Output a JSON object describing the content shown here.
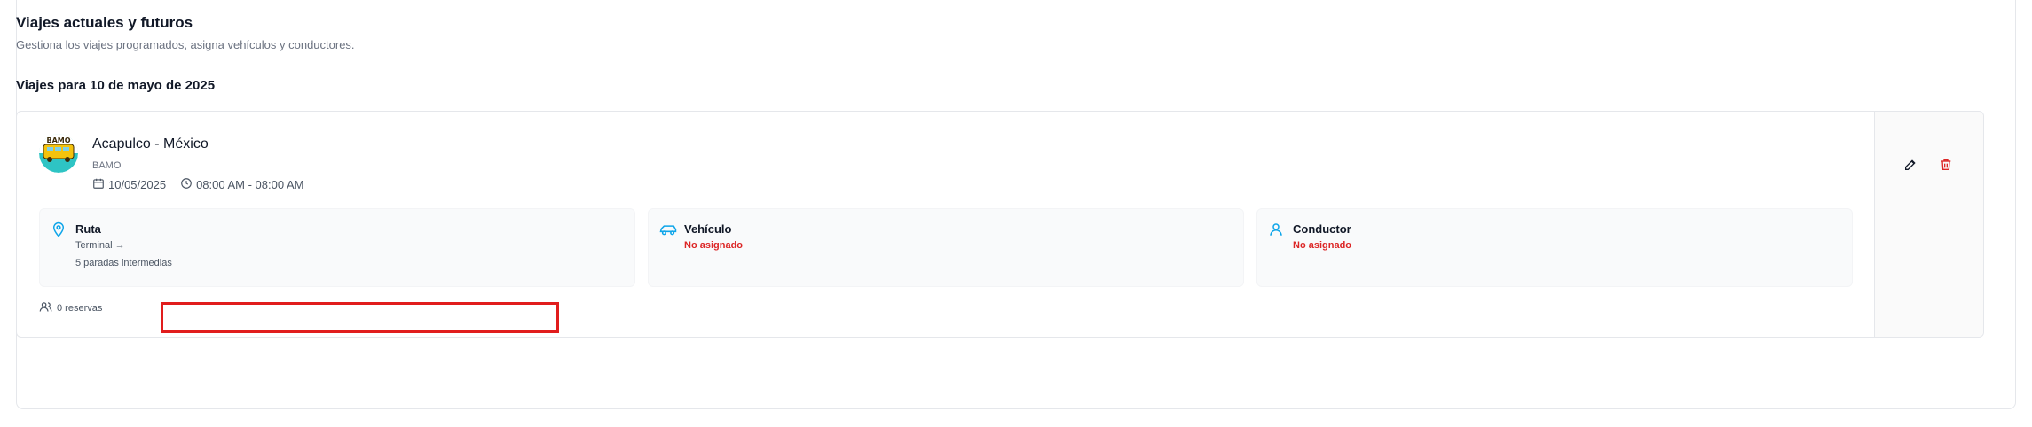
{
  "header": {
    "title": "Viajes actuales y futuros",
    "subtitle": "Gestiona los viajes programados, asigna vehículos y conductores."
  },
  "section": {
    "title": "Viajes para 10 de mayo de 2025"
  },
  "trip": {
    "name": "Acapulco - México",
    "company": "BAMO",
    "logo_text": "BAMO",
    "date": "10/05/2025",
    "time": "08:00 AM - 08:00 AM",
    "route": {
      "label": "Ruta",
      "line1": "Terminal →",
      "line2": "5 paradas intermedias"
    },
    "vehicle": {
      "label": "Vehículo",
      "status": "No asignado"
    },
    "driver": {
      "label": "Conductor",
      "status": "No asignado"
    },
    "reservations": "0 reservas"
  },
  "icons": {
    "calendar": "calendar-icon",
    "clock": "clock-icon",
    "map_pin": "map-pin-icon",
    "car": "car-icon",
    "user": "user-icon",
    "users": "users-icon",
    "edit": "pencil-icon",
    "delete": "trash-icon"
  },
  "colors": {
    "accent": "#0ea5e9",
    "danger": "#dc2626",
    "highlight": "#e11d1d"
  }
}
